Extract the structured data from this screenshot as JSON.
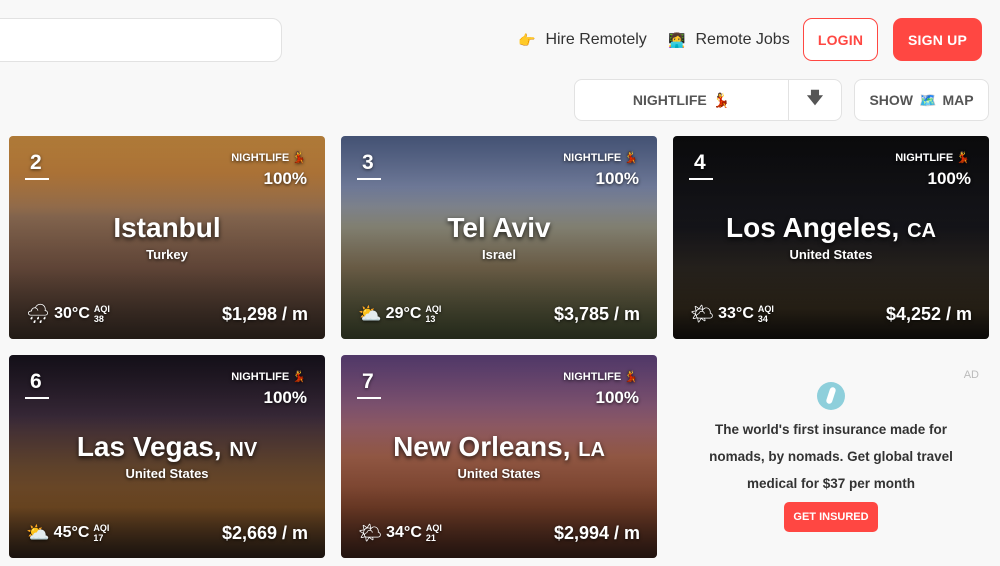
{
  "header": {
    "hire_emoji": "👉",
    "hire_label": "Hire Remotely",
    "jobs_emoji": "👩‍💻",
    "jobs_label": "Remote Jobs",
    "login_label": "LOGIN",
    "signup_label": "SIGN UP"
  },
  "toolbar": {
    "sort_label": "NIGHTLIFE",
    "sort_emoji": "💃",
    "sort_dir_icon": "🡇",
    "show_label": "SHOW",
    "map_emoji": "🗺️",
    "map_label": "MAP"
  },
  "cards": [
    {
      "rank": "2",
      "tag": "NIGHTLIFE 💃",
      "percent": "100%",
      "city": "Istanbul",
      "state": "",
      "country": "Turkey",
      "weather_icon": "🌧",
      "temp": "30°C",
      "aqi_label": "AQI",
      "aqi": "38",
      "price": "$1,298 / m"
    },
    {
      "rank": "3",
      "tag": "NIGHTLIFE 💃",
      "percent": "100%",
      "city": "Tel Aviv",
      "state": "",
      "country": "Israel",
      "weather_icon": "⛅",
      "temp": "29°C",
      "aqi_label": "AQI",
      "aqi": "13",
      "price": "$3,785 / m"
    },
    {
      "rank": "4",
      "tag": "NIGHTLIFE 💃",
      "percent": "100%",
      "city": "Los Angeles,",
      "state": "CA",
      "country": "United States",
      "weather_icon": "🌤",
      "temp": "33°C",
      "aqi_label": "AQI",
      "aqi": "34",
      "price": "$4,252 / m"
    },
    {
      "rank": "6",
      "tag": "NIGHTLIFE 💃",
      "percent": "100%",
      "city": "Las Vegas,",
      "state": "NV",
      "country": "United States",
      "weather_icon": "⛅",
      "temp": "45°C",
      "aqi_label": "AQI",
      "aqi": "17",
      "price": "$2,669 / m"
    },
    {
      "rank": "7",
      "tag": "NIGHTLIFE 💃",
      "percent": "100%",
      "city": "New Orleans,",
      "state": "LA",
      "country": "United States",
      "weather_icon": "🌤",
      "temp": "34°C",
      "aqi_label": "AQI",
      "aqi": "21",
      "price": "$2,994 / m"
    }
  ],
  "ad": {
    "tag": "AD",
    "text": "The world's first insurance made for nomads, by nomads. Get global travel medical for $37 per month",
    "button_label": "GET INSURED"
  },
  "colors": {
    "accent": "#ff4742",
    "ad_logo": "#8ecfdb"
  }
}
